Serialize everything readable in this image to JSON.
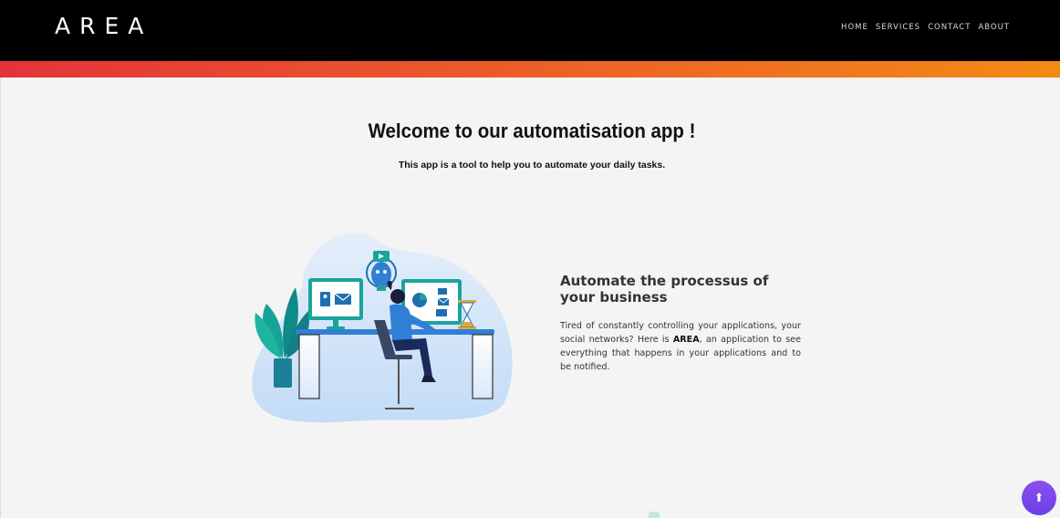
{
  "nav": {
    "brand": "AREA",
    "links": [
      "HOME",
      "SERVICES",
      "CONTACT",
      "ABOUT"
    ]
  },
  "hero": {
    "title": "Welcome to our automatisation app !",
    "subtitle": "This app is a tool to help you to automate your daily tasks."
  },
  "feature": {
    "title": "Automate the processus of your business",
    "text_before": "Tired of constantly controlling your applications, your social networks? Here is ",
    "text_strong": "AREA",
    "text_after": ", an application to see everything that happens in your applications and to be notified."
  },
  "scroll_top": {
    "icon": "arrow-up-icon",
    "glyph": "⬆"
  },
  "colors": {
    "navbar_bg": "#000000",
    "gradient_start": "#e4333a",
    "gradient_end": "#f48a14",
    "page_bg": "#f4f4f4",
    "scroll_button": "#7a45ec",
    "illustration_teal": "#1aa39a",
    "illustration_blue": "#2f7fd6"
  }
}
